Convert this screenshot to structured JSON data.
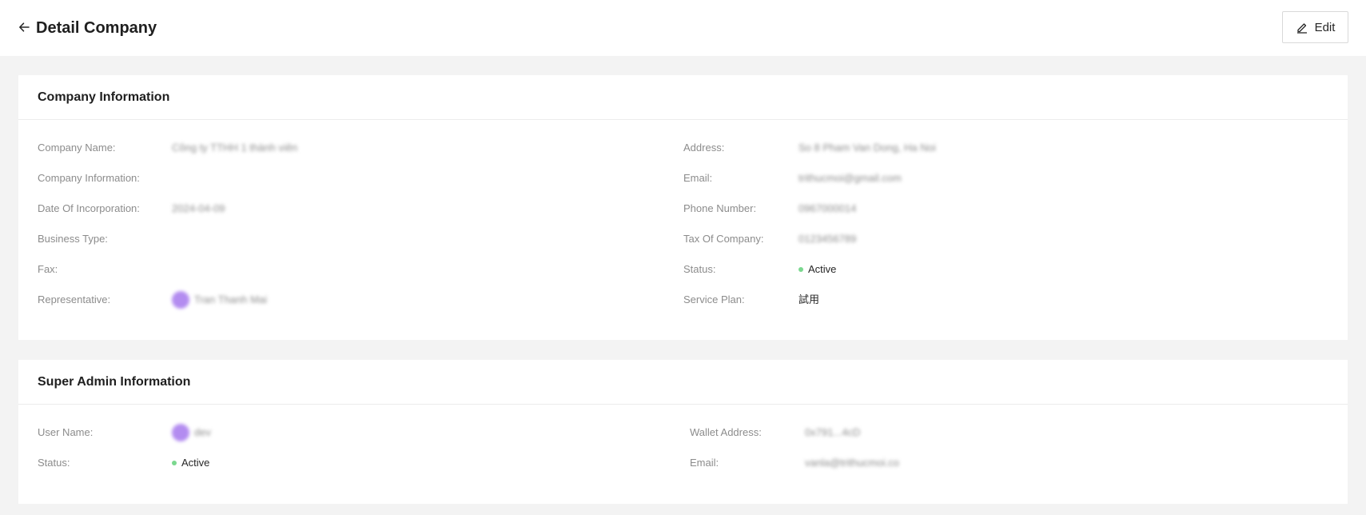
{
  "header": {
    "title": "Detail Company",
    "edit_label": "Edit"
  },
  "colors": {
    "active_dot": "#52c41a",
    "avatar": "#b38cf0"
  },
  "company": {
    "section_title": "Company Information",
    "left": [
      {
        "label": "Company Name:",
        "value": "Công ty TTHH 1 thành viên"
      },
      {
        "label": "Company Information:",
        "value": ""
      },
      {
        "label": "Date Of Incorporation:",
        "value": "2024-04-09"
      },
      {
        "label": "Business Type:",
        "value": ""
      },
      {
        "label": "Fax:",
        "value": ""
      },
      {
        "label": "Representative:",
        "value": "Tran Thanh Mai"
      }
    ],
    "right": [
      {
        "label": "Address:",
        "value": "So 8 Pham Van Dong, Ha Noi"
      },
      {
        "label": "Email:",
        "value": "trithucmoi@gmail.com"
      },
      {
        "label": "Phone Number:",
        "value": "0967000014"
      },
      {
        "label": "Tax Of Company:",
        "value": "0123456789"
      },
      {
        "label": "Status:",
        "value": "Active"
      },
      {
        "label": "Service Plan:",
        "value": "試用"
      }
    ]
  },
  "super_admin": {
    "section_title": "Super Admin Information",
    "left": [
      {
        "label": "User Name:",
        "value": "dev"
      },
      {
        "label": "Status:",
        "value": "Active"
      }
    ],
    "right": [
      {
        "label": "Wallet Address:",
        "value": "0x791...4cD"
      },
      {
        "label": "Email:",
        "value": "vanla@trithucmoi.co"
      }
    ]
  }
}
